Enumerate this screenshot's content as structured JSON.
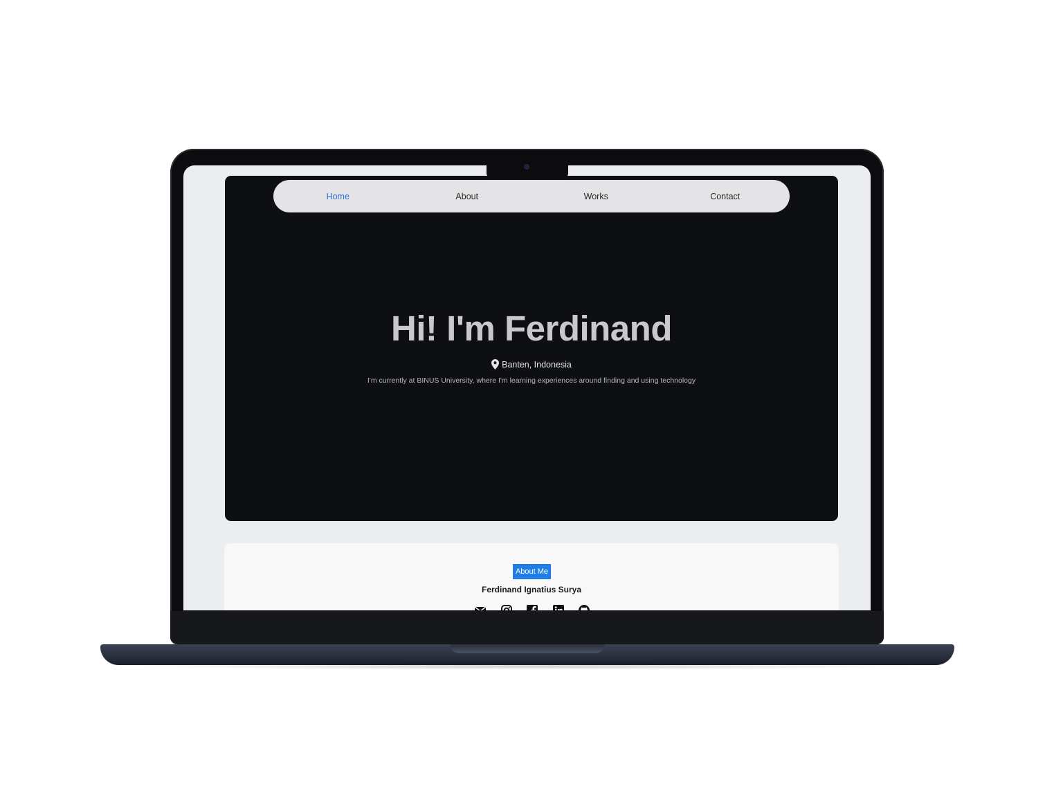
{
  "nav": {
    "items": [
      {
        "label": "Home",
        "active": true
      },
      {
        "label": "About",
        "active": false
      },
      {
        "label": "Works",
        "active": false
      },
      {
        "label": "Contact",
        "active": false
      }
    ],
    "active_color": "#2f6fd6"
  },
  "hero": {
    "title": "Hi! I'm Ferdinand",
    "location_icon": "map-pin-icon",
    "location": "Banten, Indonesia",
    "description": "I'm currently at BINUS University, where I'm learning experiences around finding and using technology"
  },
  "about": {
    "badge": "About Me",
    "badge_color": "#1f7ee6",
    "name": "Ferdinand Ignatius Surya",
    "social_icons": [
      "mail-icon",
      "instagram-icon",
      "facebook-icon",
      "linkedin-icon",
      "github-icon"
    ]
  }
}
